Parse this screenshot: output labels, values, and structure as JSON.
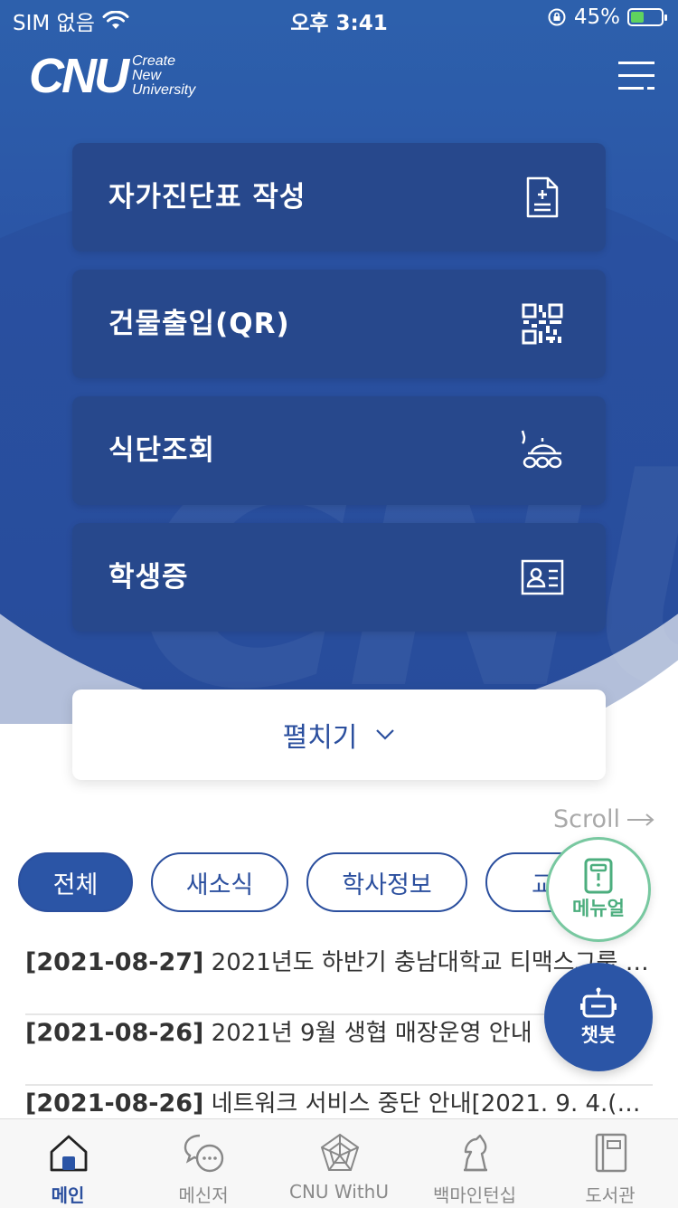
{
  "status_bar": {
    "carrier": "SIM 없음",
    "time": "오후 3:41",
    "battery": "45%",
    "battery_level": 0.45
  },
  "header": {
    "logo_main": "CNU",
    "logo_sub": [
      "Create",
      "New",
      "University"
    ]
  },
  "menu_cards": [
    {
      "label": "자가진단표 작성",
      "icon": "document-plus-icon"
    },
    {
      "label": "건물출입(QR)",
      "icon": "qr-code-icon"
    },
    {
      "label": "식단조회",
      "icon": "food-tray-icon"
    },
    {
      "label": "학생증",
      "icon": "id-card-icon"
    }
  ],
  "expand_button": {
    "label": "펼치기"
  },
  "scroll_hint": "Scroll",
  "category_chips": [
    {
      "label": "전체",
      "active": true
    },
    {
      "label": "새소식",
      "active": false
    },
    {
      "label": "학사정보",
      "active": false
    },
    {
      "label": "교육",
      "active": false
    }
  ],
  "news": [
    {
      "date": "[2021-08-27]",
      "title": "2021년도 하반기 충남대학교 티맥스그룹 채…"
    },
    {
      "date": "[2021-08-26]",
      "title": "2021년 9월 생협 매장운영 안내"
    },
    {
      "date": "[2021-08-26]",
      "title": "네트워크 서비스 중단 안내[2021. 9. 4.(토), …"
    }
  ],
  "floating": {
    "manual_label": "메뉴얼",
    "chatbot_label": "챗봇"
  },
  "tabbar": [
    {
      "label": "메인",
      "icon": "home-icon",
      "active": true
    },
    {
      "label": "메신저",
      "icon": "chat-bubbles-icon",
      "active": false
    },
    {
      "label": "CNU WithU",
      "icon": "radar-chart-icon",
      "active": false
    },
    {
      "label": "백마인턴십",
      "icon": "horse-icon",
      "active": false
    },
    {
      "label": "도서관",
      "icon": "book-icon",
      "active": false
    }
  ],
  "colors": {
    "primary": "#2b55a6",
    "card": "#27488c",
    "manual": "#4cae7e"
  }
}
